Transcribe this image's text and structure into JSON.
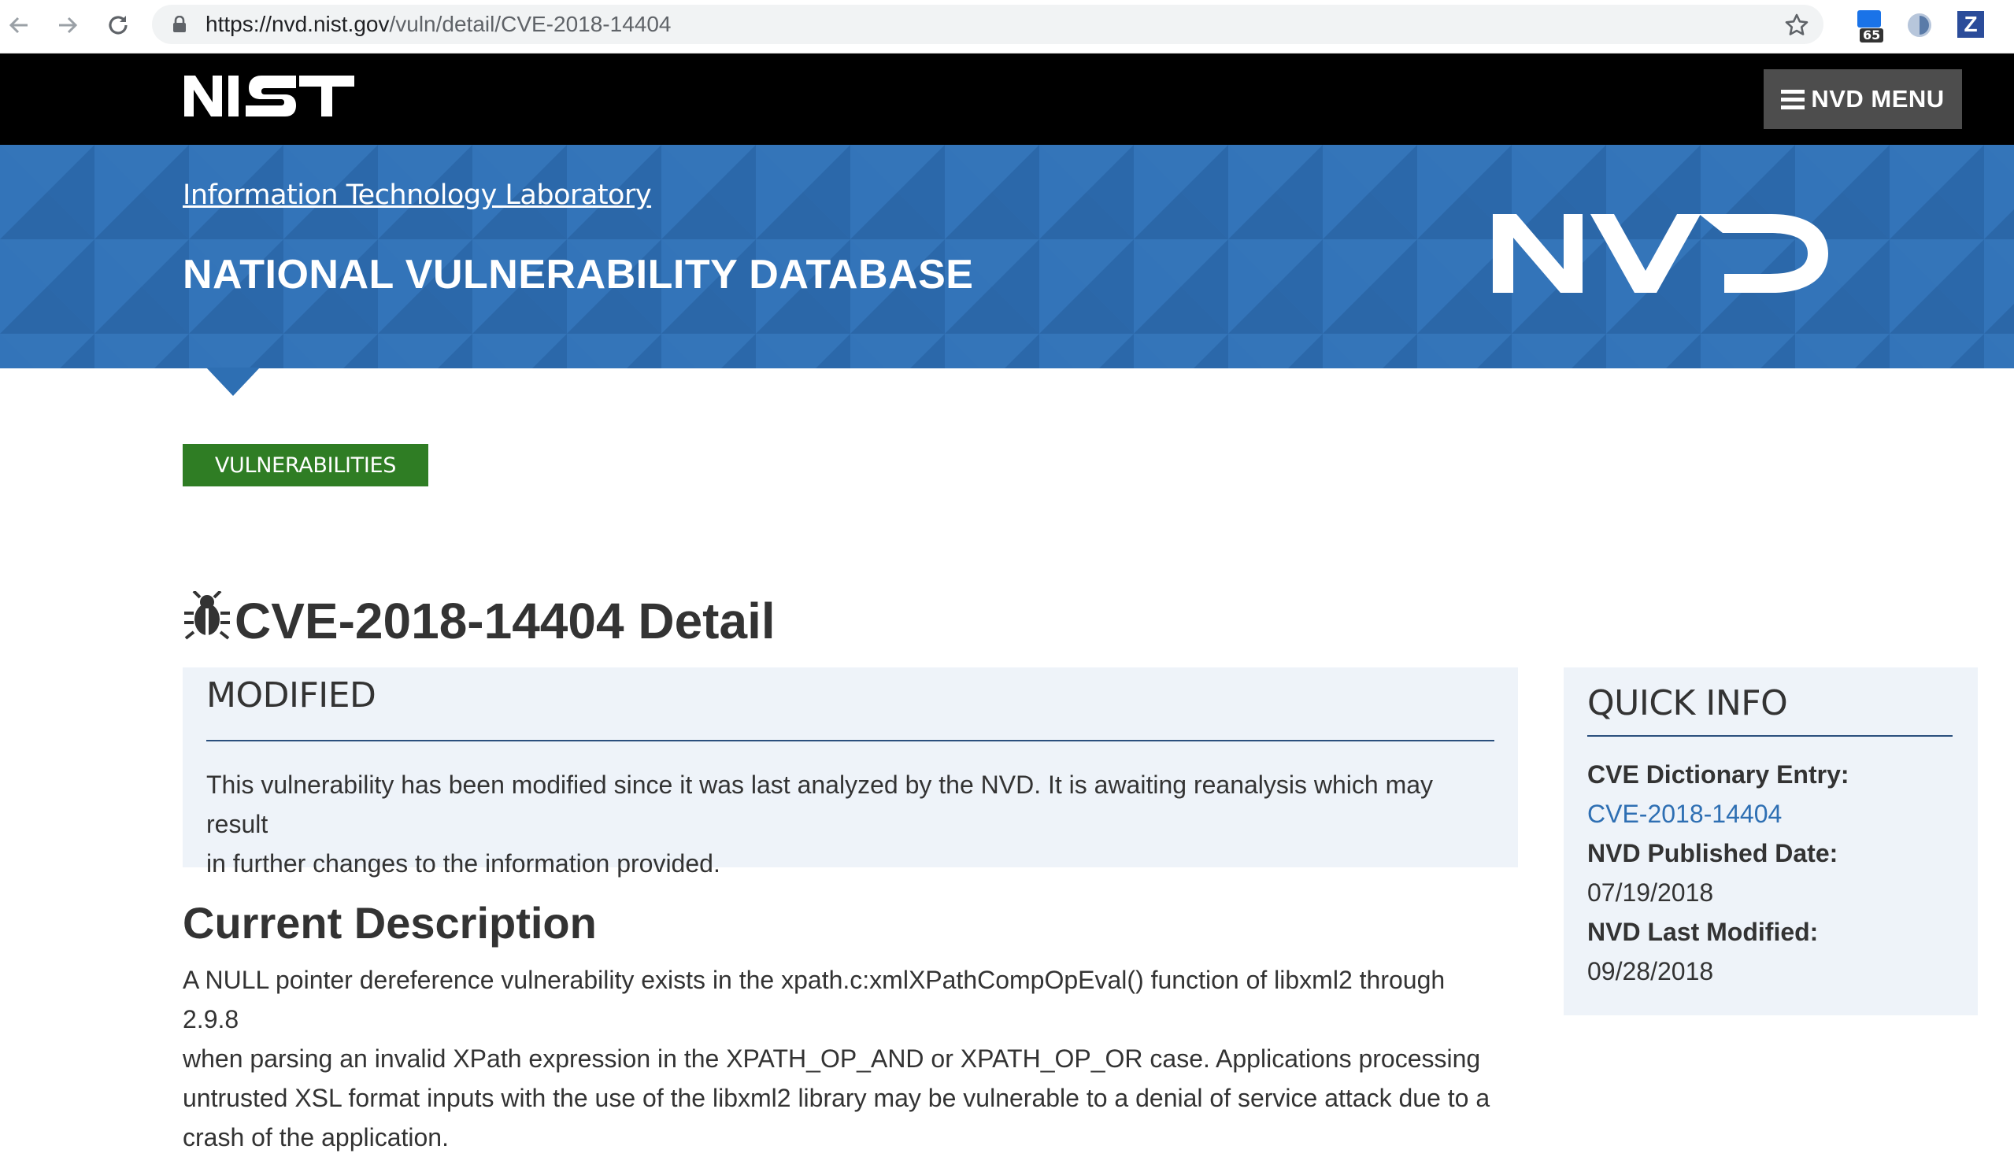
{
  "browser": {
    "url_host": "https://nvd.nist.gov",
    "url_path": "/vuln/detail/CVE-2018-14404",
    "extension_badge": "65",
    "extension_z": "Z"
  },
  "header": {
    "logo": "NIST",
    "menu_label": "NVD MENU"
  },
  "banner": {
    "lab_link": "Information Technology Laboratory",
    "title": "NATIONAL VULNERABILITY DATABASE",
    "logo": "NVD"
  },
  "breadcrumb": {
    "label": "VULNERABILITIES"
  },
  "page": {
    "title": "CVE-2018-14404 Detail"
  },
  "modified": {
    "heading": "MODIFIED",
    "line1": "This vulnerability has been modified since it was last analyzed by the NVD. It is awaiting reanalysis which may result",
    "line2": "in further changes to the information provided."
  },
  "description": {
    "heading": "Current Description",
    "line1": "A NULL pointer dereference vulnerability exists in the xpath.c:xmlXPathCompOpEval() function of libxml2 through 2.9.8",
    "line2": "when parsing an invalid XPath expression in the XPATH_OP_AND or XPATH_OP_OR case. Applications processing",
    "line3": "untrusted XSL format inputs with the use of the libxml2 library may be vulnerable to a denial of service attack due to a",
    "line4": "crash of the application."
  },
  "quick_info": {
    "heading": "QUICK INFO",
    "cve_label": "CVE Dictionary Entry:",
    "cve_value": "CVE-2018-14404",
    "published_label": "NVD Published Date:",
    "published_value": "07/19/2018",
    "modified_label": "NVD Last Modified:",
    "modified_value": "09/28/2018"
  },
  "colors": {
    "banner_blue": "#2e6fb3",
    "crumb_green": "#2f7d24",
    "panel_bg": "#eef3f9",
    "link_blue": "#2e6fb3"
  }
}
